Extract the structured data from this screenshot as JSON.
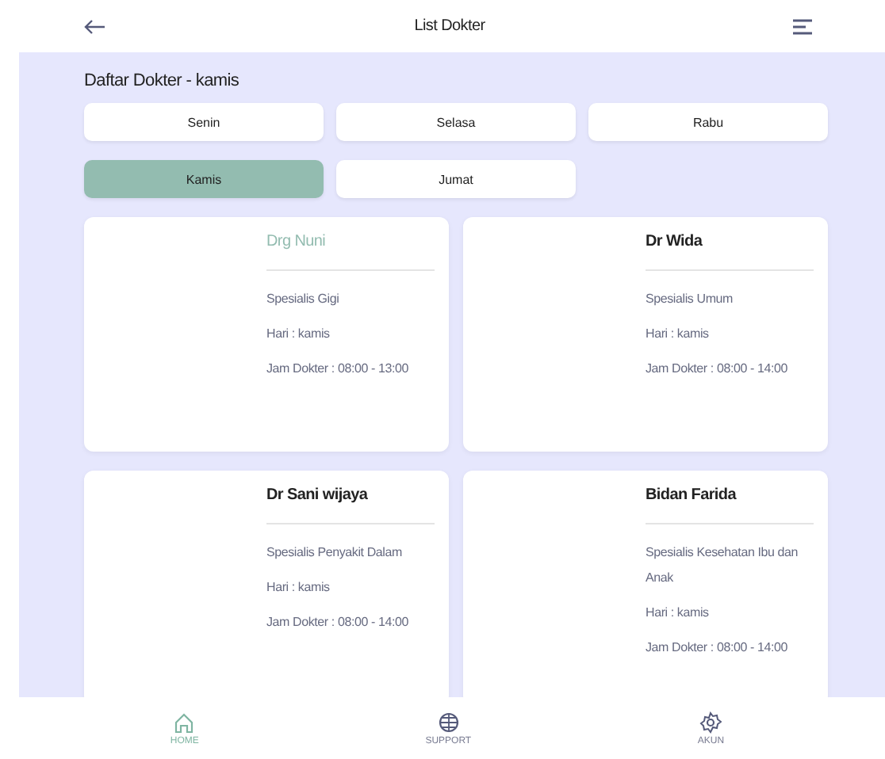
{
  "header": {
    "title": "List Dokter"
  },
  "heading": "Daftar Dokter - kamis",
  "days": [
    {
      "label": "Senin",
      "selected": false
    },
    {
      "label": "Selasa",
      "selected": false
    },
    {
      "label": "Rabu",
      "selected": false
    },
    {
      "label": "Kamis",
      "selected": true
    },
    {
      "label": "Jumat",
      "selected": false
    }
  ],
  "doctors": [
    {
      "name": "Drg Nuni",
      "highlighted": true,
      "specialty": "Spesialis Gigi",
      "day": "Hari : kamis",
      "hours": "Jam Dokter : 08:00 - 13:00"
    },
    {
      "name": "Dr Wida",
      "highlighted": false,
      "specialty": "Spesialis Umum",
      "day": "Hari : kamis",
      "hours": "Jam Dokter : 08:00 - 14:00"
    },
    {
      "name": "Dr Sani wijaya",
      "highlighted": false,
      "specialty": "Spesialis Penyakit Dalam",
      "day": "Hari : kamis",
      "hours": "Jam Dokter : 08:00 - 14:00"
    },
    {
      "name": "Bidan Farida",
      "highlighted": false,
      "specialty": "Spesialis Kesehatan Ibu dan Anak",
      "day": "Hari : kamis",
      "hours": "Jam Dokter : 08:00 - 14:00"
    }
  ],
  "nav": [
    {
      "kind": "home",
      "label": "HOME",
      "selected": true
    },
    {
      "kind": "support",
      "label": "SUPPORT",
      "selected": false
    },
    {
      "kind": "account",
      "label": "AKUN",
      "selected": false
    }
  ]
}
